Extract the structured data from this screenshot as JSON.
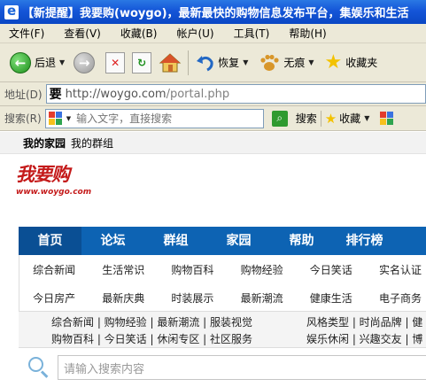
{
  "window": {
    "title": "【新提醒】我要购(woygo)，最新最快的购物信息发布平台，集娱乐和生活"
  },
  "menubar": {
    "items": [
      "文件(F)",
      "查看(V)",
      "收藏(B)",
      "帐户(U)",
      "工具(T)",
      "帮助(H)"
    ]
  },
  "toolbar": {
    "back_label": "后退",
    "restore_label": "恢复",
    "notrace_label": "无痕",
    "favorites_label": "收藏夹"
  },
  "address": {
    "label": "地址(D)",
    "favicon": "要",
    "host": "http://woygo.com",
    "path": "/portal.php"
  },
  "search": {
    "label": "搜索(R)",
    "placeholder": "输入文字，直接搜索",
    "button": "搜索",
    "favorites": "收藏"
  },
  "site": {
    "toplinks": {
      "home": "我的家园",
      "groups": "我的群组"
    },
    "logo": {
      "text": "我要购",
      "url": "www.woygo.com"
    },
    "nav": [
      "首页",
      "论坛",
      "群组",
      "家园",
      "帮助",
      "排行榜"
    ],
    "subnav": {
      "row1": [
        "综合新闻",
        "生活常识",
        "购物百科",
        "购物经验",
        "今日笑话",
        "实名认证"
      ],
      "row2": [
        "今日房产",
        "最新庆典",
        "时装展示",
        "最新潮流",
        "健康生活",
        "电子商务"
      ]
    },
    "links": {
      "line1_left": "综合新闻 | 购物经验 | 最新潮流 | 服装视觉",
      "line1_right": "风格类型 | 时尚品牌 | 健",
      "line2_left": "购物百科 | 今日笑话 | 休闲专区 | 社区服务",
      "line2_right": "娱乐休闲 | 兴趣交友 | 博"
    },
    "search_placeholder": "请输入搜索内容"
  },
  "colors": {
    "nav_bg": "#0d63b3",
    "nav_active": "#0a4f94",
    "titlebar": "#1455d8",
    "chrome": "#ece9d8"
  }
}
